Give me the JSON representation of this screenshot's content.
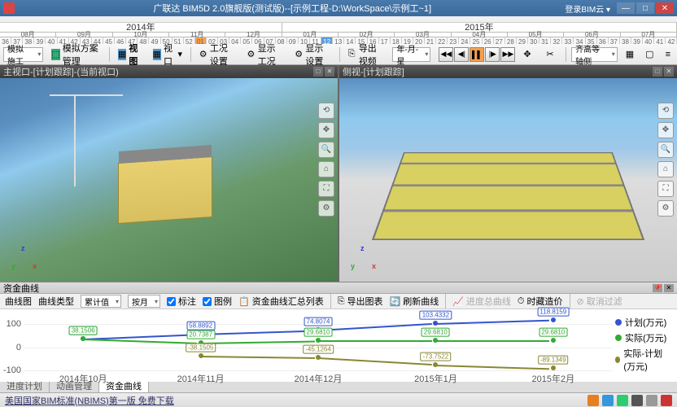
{
  "app": {
    "title": "广联达 BIM5D 2.0旗舰版(测试版)--[示例工程-D:\\WorkSpace\\示例工~1]",
    "user": "登录BIM云 ▾"
  },
  "timeline": {
    "years": [
      {
        "label": "2014年",
        "flex": 5
      },
      {
        "label": "2015年",
        "flex": 7
      }
    ],
    "months": [
      "08月",
      "09月",
      "10月",
      "11月",
      "12月",
      "01月",
      "02月",
      "03月",
      "04月",
      "05月",
      "06月",
      "07月"
    ],
    "weeks": [
      "36",
      "37",
      "38",
      "39",
      "40",
      "41",
      "42",
      "43",
      "44",
      "45",
      "46",
      "47",
      "48",
      "49",
      "50",
      "51",
      "52",
      "01",
      "02",
      "03",
      "04",
      "05",
      "06",
      "07",
      "08",
      "09",
      "10",
      "11",
      "12",
      "13",
      "14",
      "15",
      "16",
      "17",
      "18",
      "19",
      "20",
      "21",
      "22",
      "23",
      "24",
      "25",
      "26",
      "27",
      "28",
      "29",
      "30",
      "31",
      "32",
      "33",
      "34",
      "35",
      "36",
      "37",
      "38",
      "39",
      "40",
      "41",
      "42"
    ],
    "highlight_index": 17,
    "blue_index": 28
  },
  "toolbar": {
    "mode": "模拟施工",
    "scheme": "模拟方案管理",
    "view_bold": "视图",
    "view": "视口",
    "sim_set": "工况设置",
    "disp_set": "显示工况",
    "disp_opt": "显示设置",
    "export": "导出视频",
    "time_fmt": "年-月-星",
    "align": "齐高等轴侧"
  },
  "viewports": {
    "left_title": "主视口-[计划跟踪]-(当前视口)",
    "right_title": "侧视-[计划跟踪]"
  },
  "chart": {
    "panel_title": "资金曲线",
    "tb": {
      "curve": "曲线图",
      "type_lbl": "曲线类型",
      "cum": "累计值",
      "unit": "按月",
      "mark": "标注",
      "legend": "图例",
      "summary": "资金曲线汇总列表",
      "export": "导出图表",
      "refresh": "刷新曲线",
      "prog": "进度总曲线",
      "time": "时藏造价",
      "cancel": "取消过滤"
    },
    "legend": {
      "plan": "计划(万元)",
      "actual": "实际(万元)",
      "diff": "实际-计划(万元)"
    }
  },
  "chart_data": {
    "type": "line",
    "x": [
      "2014年10月",
      "2014年11月",
      "2014年12月",
      "2015年1月",
      "2015年2月"
    ],
    "ylim": [
      -100,
      150
    ],
    "yticks": [
      -100,
      0,
      100
    ],
    "series": [
      {
        "name": "计划(万元)",
        "color": "#3355cc",
        "values": [
          38.1506,
          58.8892,
          74.8074,
          103.4332,
          118.8159
        ]
      },
      {
        "name": "实际(万元)",
        "color": "#33aa33",
        "values": [
          38.1506,
          20.7387,
          29.681,
          29.681,
          29.681
        ]
      },
      {
        "name": "实际-计划(万元)",
        "color": "#888833",
        "values": [
          null,
          -38.1505,
          -45.1264,
          -73.7522,
          -89.1349
        ]
      }
    ]
  },
  "tabs": {
    "t1": "进度计划",
    "t2": "动画管理",
    "t3": "资金曲线"
  },
  "status": {
    "text": "美国国家BIM标准(NBIMS)第一版 免费下载"
  }
}
